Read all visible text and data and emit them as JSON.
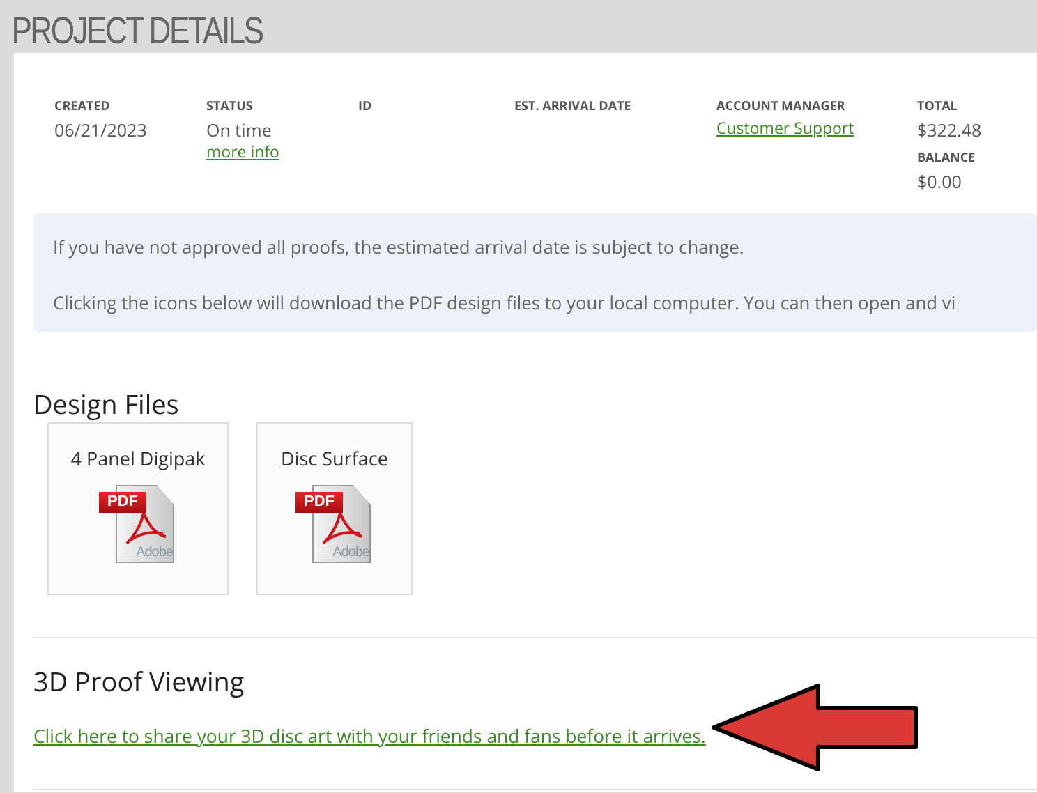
{
  "page_title": "PROJECT DETAILS",
  "summary": [
    {
      "label": "CREATED",
      "value": "06/21/2023"
    },
    {
      "label": "STATUS",
      "value": "On time",
      "link": "more info"
    },
    {
      "label": "ID"
    },
    {
      "label": "EST. ARRIVAL DATE"
    },
    {
      "label": "ACCOUNT MANAGER",
      "manager_link": "Customer Support"
    },
    {
      "label": "TOTAL",
      "value": "$322.48",
      "label_2": "BALANCE",
      "value_2": "$0.00"
    }
  ],
  "notice": [
    "If you have not approved all proofs, the estimated arrival date is subject to change.",
    "Clicking the icons below will download the PDF design files to your local computer. You can then open and vi"
  ],
  "design_files": {
    "heading": "Design Files",
    "files": [
      {
        "name": "4 Panel Digipak",
        "icon_badge": "PDF",
        "icon_brand": "Adobe"
      },
      {
        "name": "Disc Surface",
        "icon_badge": "PDF",
        "icon_brand": "Adobe"
      }
    ]
  },
  "proof_viewing": {
    "heading": "3D Proof Viewing",
    "link": "Click here to share your 3D disc art with your friends and fans before it arrives."
  }
}
